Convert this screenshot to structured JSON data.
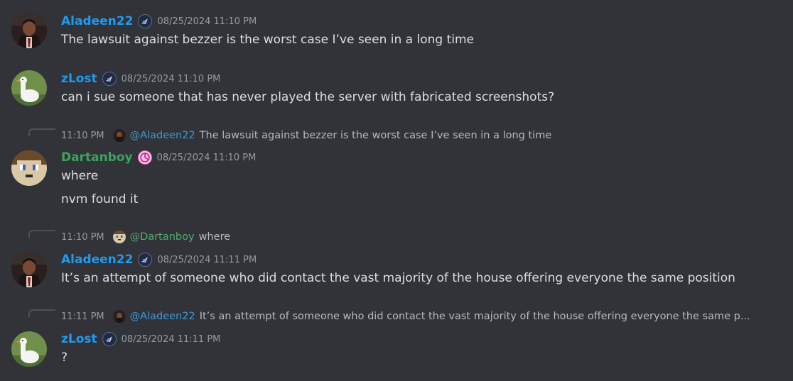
{
  "colors": {
    "background": "#313338",
    "username_blue": "#1e9bf0",
    "username_green": "#3ba55c",
    "text": "#dbdee1",
    "timestamp": "#949ba4"
  },
  "messages": [
    {
      "author": "Aladeen22",
      "avatar": "aladeen-avatar",
      "badge": "clan-badge-icon",
      "timestamp": "08/25/2024 11:10 PM",
      "lines": [
        "The lawsuit against bezzer is the worst case I’ve seen in a long time"
      ]
    },
    {
      "author": "zLost",
      "avatar": "goose-avatar",
      "badge": "clan-badge-icon",
      "timestamp": "08/25/2024 11:10 PM",
      "lines": [
        "can i sue someone that has never played the server with fabricated screenshots?"
      ]
    },
    {
      "author": "Dartanboy",
      "avatar": "pixel-face-avatar",
      "badge": "pink-badge-icon",
      "timestamp": "08/25/2024 11:10 PM",
      "reply": {
        "time": "11:10 PM",
        "mention": "@Aladeen22",
        "text": "The lawsuit against bezzer is the worst case I’ve seen in a long time"
      },
      "lines": [
        "where",
        "nvm found it"
      ]
    },
    {
      "author": "Aladeen22",
      "avatar": "aladeen-avatar",
      "badge": "clan-badge-icon",
      "timestamp": "08/25/2024 11:11 PM",
      "reply": {
        "time": "11:10 PM",
        "mention": "@Dartanboy",
        "text": "where"
      },
      "lines": [
        "It’s an attempt of someone who did contact the vast majority of the house offering everyone the same position"
      ]
    },
    {
      "author": "zLost",
      "avatar": "goose-avatar",
      "badge": "clan-badge-icon",
      "timestamp": "08/25/2024 11:11 PM",
      "reply": {
        "time": "11:11 PM",
        "mention": "@Aladeen22",
        "text": "It’s an attempt of someone who did contact the vast majority of the house offering everyone the same p..."
      },
      "lines": [
        "?"
      ]
    }
  ]
}
